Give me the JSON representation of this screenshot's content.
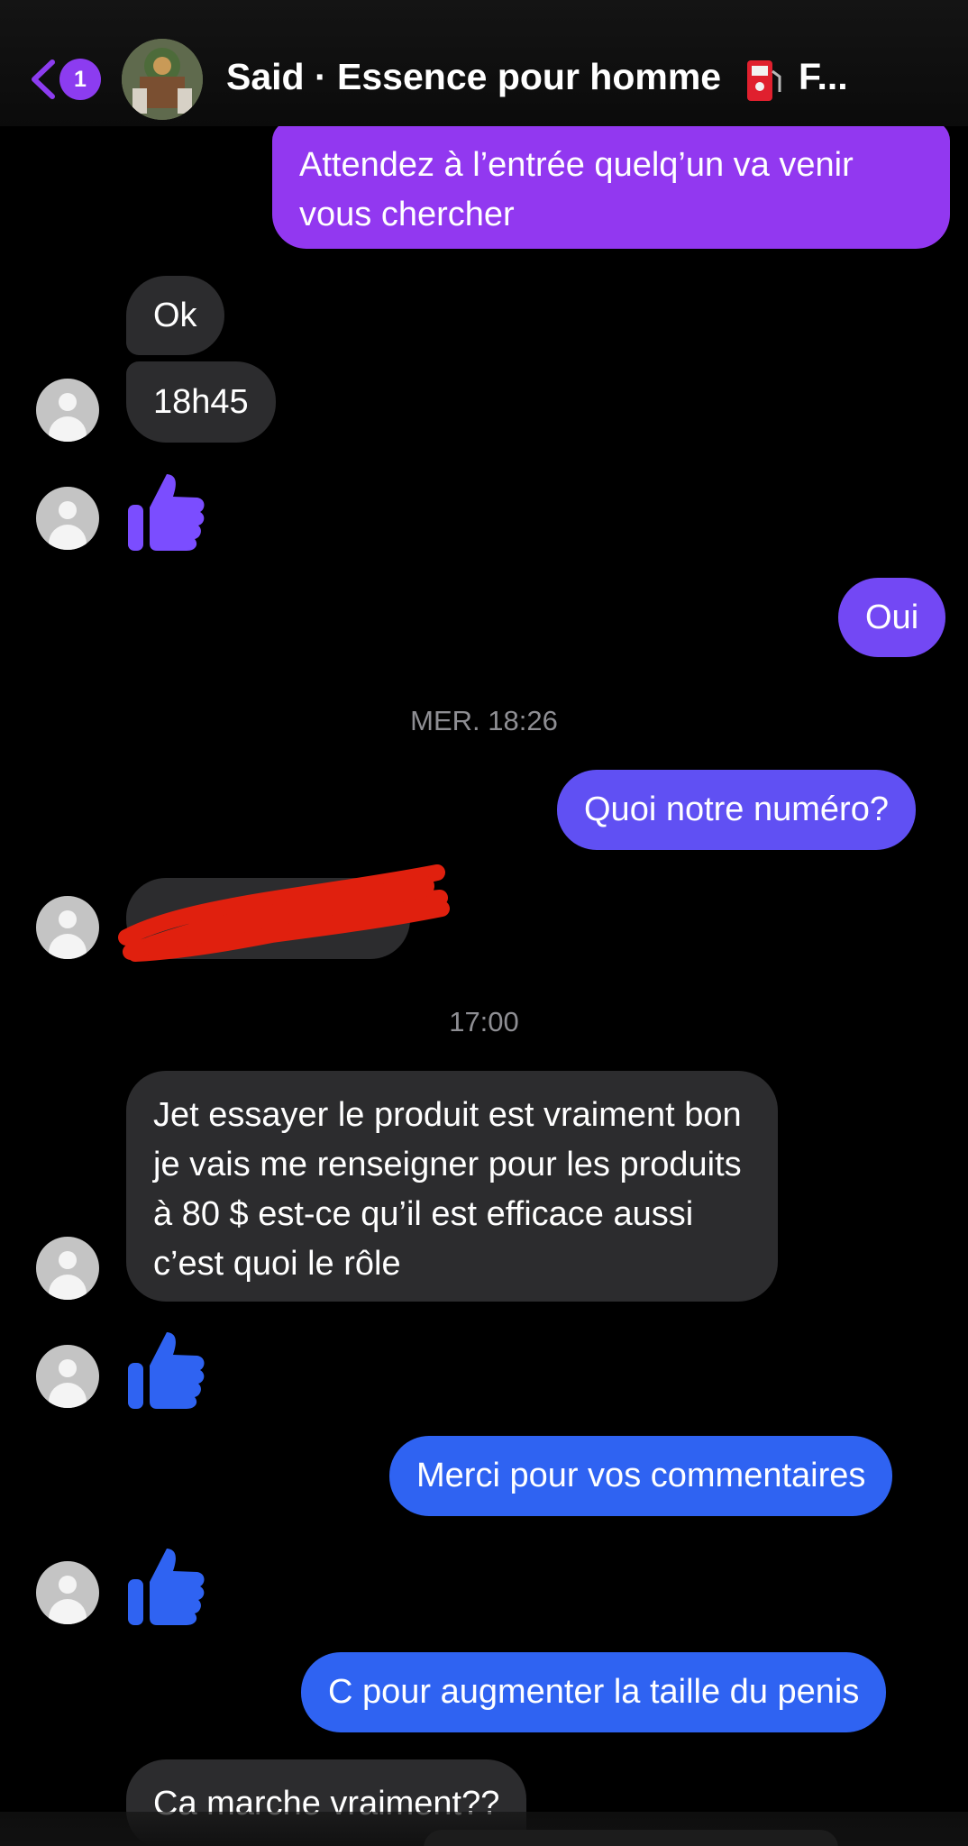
{
  "header": {
    "badge_count": "1",
    "title": "Said · Essence pour homme",
    "title_suffix": "F...",
    "icons": [
      "back-chevron-icon",
      "fuel-pump-icon"
    ]
  },
  "messages": [
    {
      "type": "sent",
      "text": "Attendez à l’entrée quelq’un va venir vous chercher"
    },
    {
      "type": "received",
      "text": "Ok"
    },
    {
      "type": "received",
      "text": "18h45"
    },
    {
      "type": "received-reaction",
      "icon": "thumbs-up-icon",
      "color": "#7b4dff"
    },
    {
      "type": "sent",
      "text": "Oui"
    },
    {
      "type": "timestamp",
      "text": "MER. 18:26"
    },
    {
      "type": "sent",
      "text": "Quoi notre numéro?"
    },
    {
      "type": "received",
      "text": "",
      "redacted": true
    },
    {
      "type": "timestamp",
      "text": "17:00"
    },
    {
      "type": "received",
      "text": "Jet essayer le produit est vraiment bon je vais me renseigner pour les produits à 80 $ est-ce qu’il est efficace aussi c’est quoi le rôle"
    },
    {
      "type": "received-reaction",
      "icon": "thumbs-up-icon",
      "color": "#2f63f2"
    },
    {
      "type": "sent",
      "text": "Merci pour vos commentaires"
    },
    {
      "type": "received-reaction",
      "icon": "thumbs-up-icon",
      "color": "#2f63f2"
    },
    {
      "type": "sent",
      "text": "C pour augmenter la taille du penis"
    },
    {
      "type": "received",
      "text": "Ca marche vraiment??"
    }
  ],
  "colors": {
    "sent_purple": "#9238f0",
    "sent_violet": "#7348f4",
    "sent_blue": "#2f63f2",
    "received_gray": "#2c2c2e",
    "redaction_red": "#e0200e"
  }
}
